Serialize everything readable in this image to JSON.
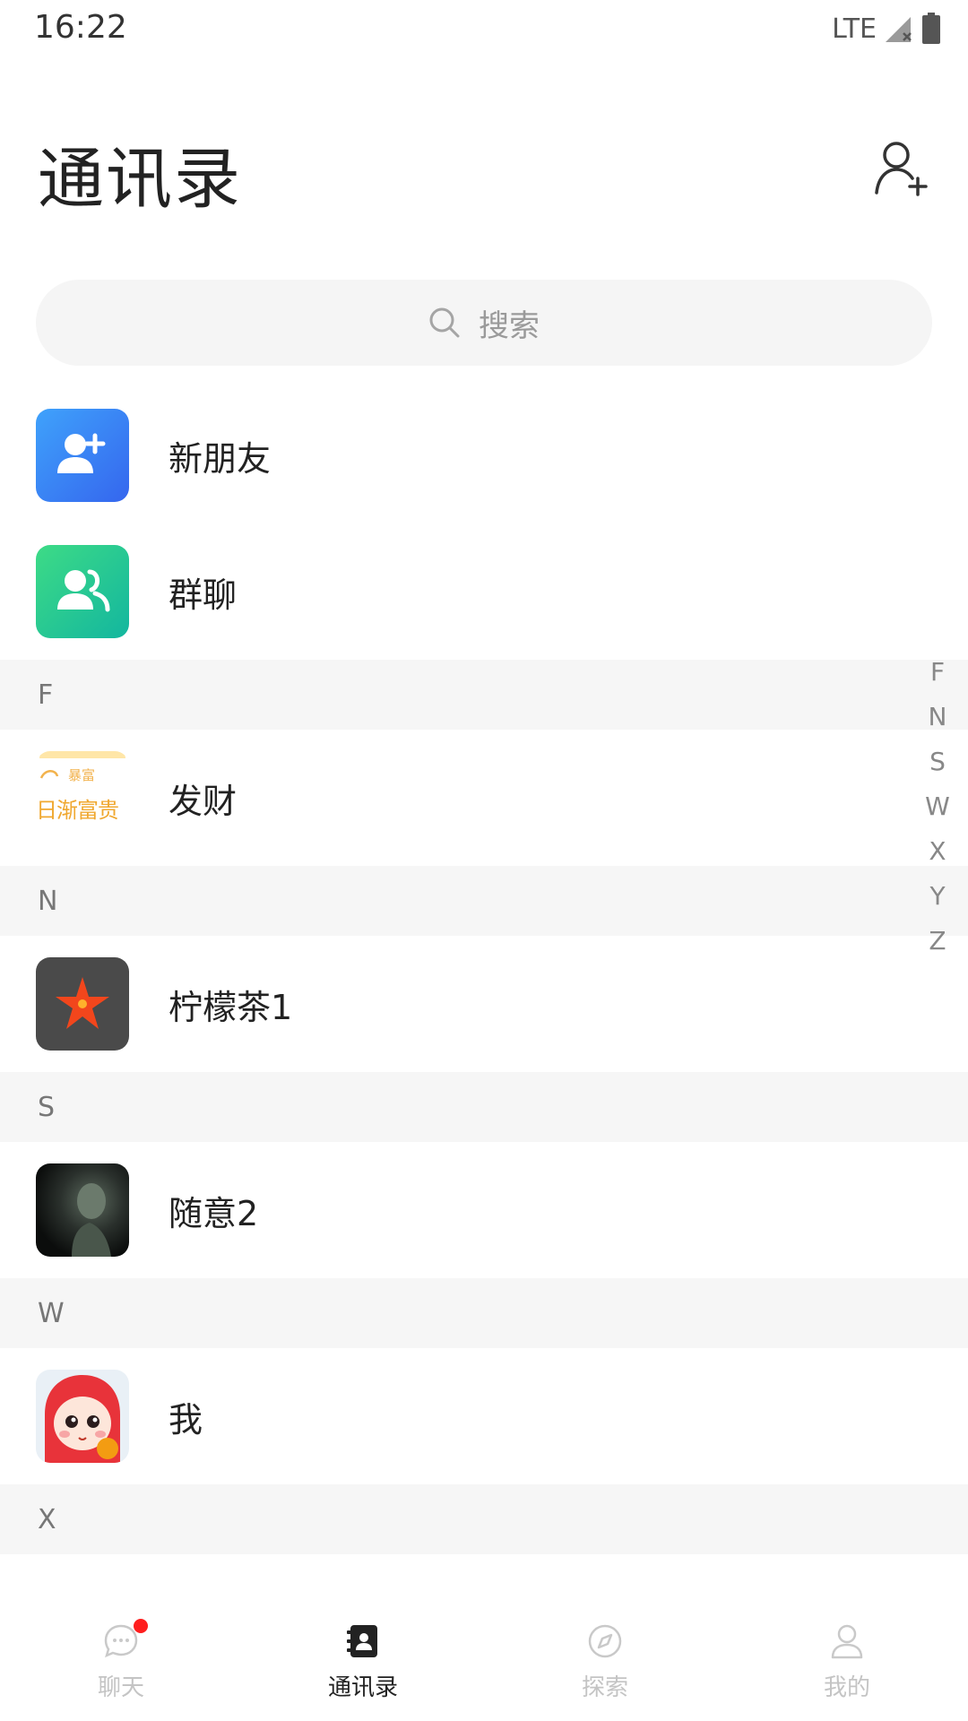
{
  "status": {
    "time": "16:22",
    "network": "LTE"
  },
  "header": {
    "title": "通讯录"
  },
  "search": {
    "placeholder": "搜索"
  },
  "fixed_items": [
    {
      "label": "新朋友",
      "icon": "add-user-icon",
      "color": "#3a78f2"
    },
    {
      "label": "群聊",
      "icon": "group-icon",
      "color": "#22c08e"
    }
  ],
  "sections": [
    {
      "letter": "F",
      "contacts": [
        {
          "name": "发财",
          "avatar_text": "日渐富贵",
          "avatar_small": "暴富"
        }
      ]
    },
    {
      "letter": "N",
      "contacts": [
        {
          "name": "柠檬茶1"
        }
      ]
    },
    {
      "letter": "S",
      "contacts": [
        {
          "name": "随意2"
        }
      ]
    },
    {
      "letter": "W",
      "contacts": [
        {
          "name": "我"
        }
      ]
    },
    {
      "letter": "X",
      "contacts": []
    }
  ],
  "index": [
    "F",
    "N",
    "S",
    "W",
    "X",
    "Y",
    "Z"
  ],
  "nav": [
    {
      "label": "聊天",
      "icon": "chat-icon",
      "badge": true
    },
    {
      "label": "通讯录",
      "icon": "contacts-icon",
      "active": true
    },
    {
      "label": "探索",
      "icon": "compass-icon"
    },
    {
      "label": "我的",
      "icon": "profile-icon"
    }
  ]
}
